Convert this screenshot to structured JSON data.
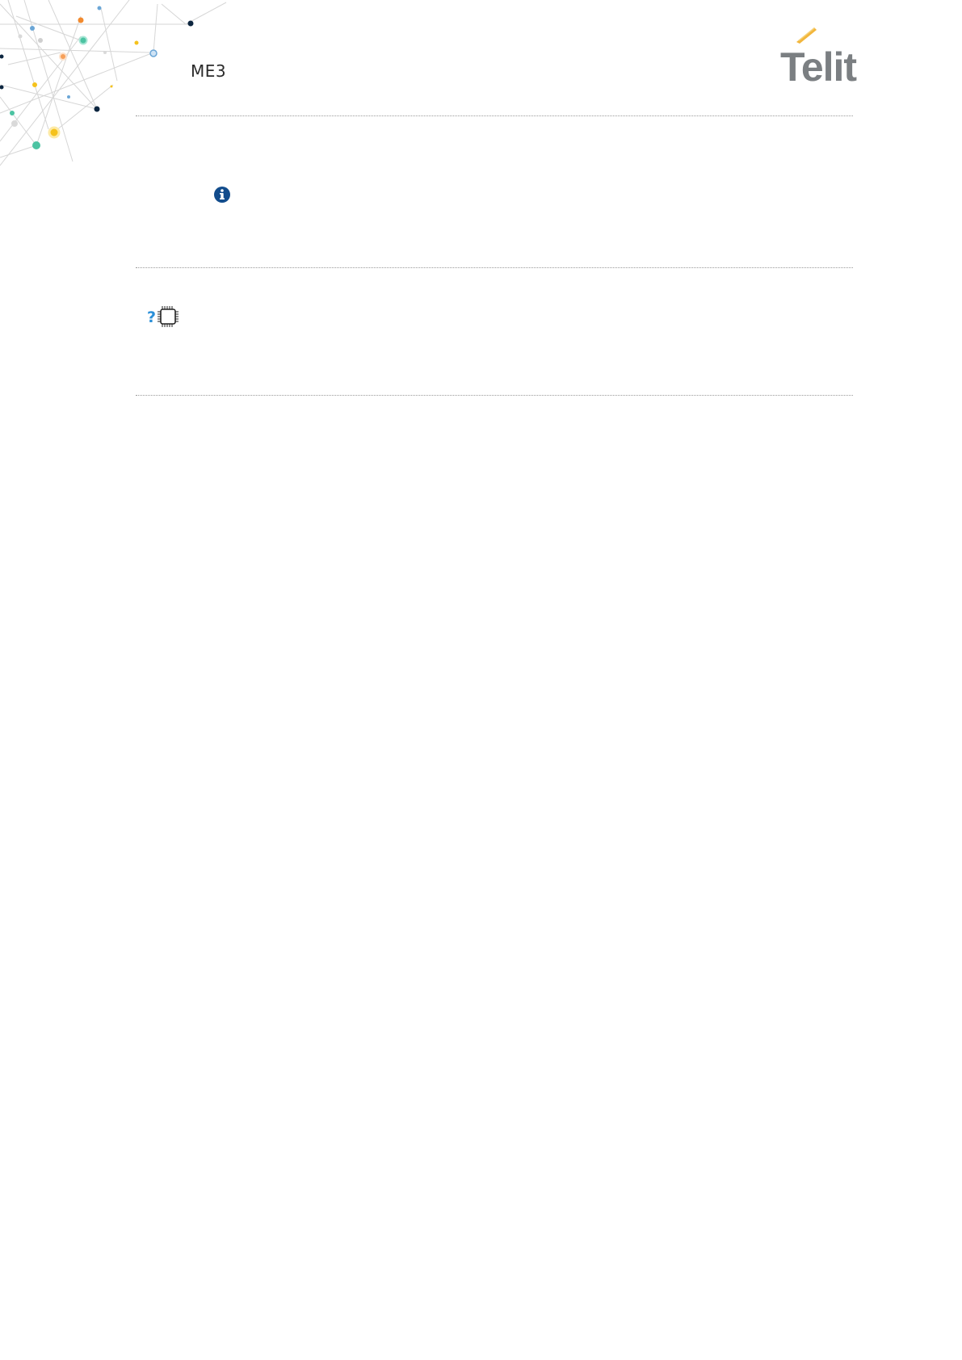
{
  "header": {
    "title": "ME3",
    "logo_text": "Telit"
  },
  "colors": {
    "logo_gray": "#7b7f82",
    "logo_accent": "#f2b63c",
    "info_blue": "#124c8c",
    "question_blue": "#2a8fd8",
    "divider": "#9a9a9a"
  },
  "icons": {
    "note_1": "info-icon",
    "note_2": "question-chip-icon"
  },
  "notes": [
    {
      "icon": "info-icon",
      "text": ""
    },
    {
      "icon": "question-chip-icon",
      "text": ""
    }
  ]
}
